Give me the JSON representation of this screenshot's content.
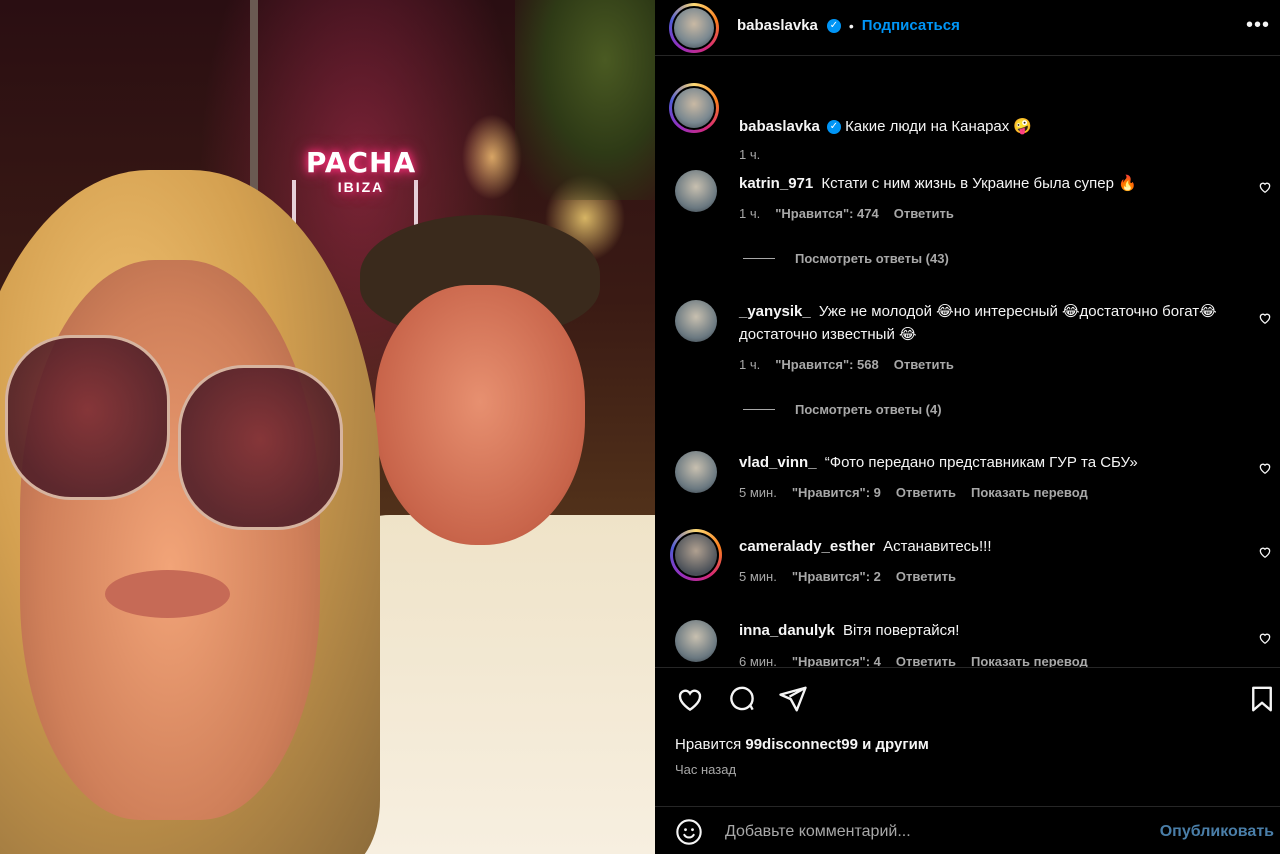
{
  "header": {
    "username": "babaslavka",
    "verified_icon": "verified-badge-icon",
    "follow_label": "Подписаться",
    "more_icon": "more-options-icon"
  },
  "caption": {
    "username": "babaslavka",
    "text": "Какие люди на Канарах 🤪",
    "time": "1 ч."
  },
  "photo": {
    "sign_text": "PACHA",
    "sign_subtext": "IBIZA"
  },
  "comments": [
    {
      "username": "katrin_971",
      "text": "Кстати с ним жизнь в Украине была супер 🔥",
      "time": "1 ч.",
      "likes": "\"Нравится\": 474",
      "reply": "Ответить",
      "view_replies": "Посмотреть ответы (43)"
    },
    {
      "username": "_yanysik_",
      "text": "Уже не молодой 😂но интересный 😂достаточно богат😂 достаточно известный 😂",
      "time": "1 ч.",
      "likes": "\"Нравится\": 568",
      "reply": "Ответить",
      "view_replies": "Посмотреть ответы (4)"
    },
    {
      "username": "vlad_vinn_",
      "text": "“Фото передано представникам ГУР та СБУ»",
      "time": "5 мин.",
      "likes": "\"Нравится\": 9",
      "reply": "Ответить",
      "translate": "Показать перевод"
    },
    {
      "username": "cameralady_esther",
      "text": "Астанавитесь!!!",
      "time": "5 мин.",
      "likes": "\"Нравится\": 2",
      "reply": "Ответить"
    },
    {
      "username": "inna_danulyk",
      "text": "Вітя повертайся!",
      "time": "6 мин.",
      "likes": "\"Нравится\": 4",
      "reply": "Ответить",
      "translate": "Показать перевод"
    }
  ],
  "actions": {
    "like_icon": "heart-icon",
    "comment_icon": "comment-icon",
    "share_icon": "share-icon",
    "save_icon": "bookmark-icon"
  },
  "likes_summary": {
    "prefix": "Нравится",
    "user": "99disconnect99",
    "suffix": "и другим"
  },
  "post_time": "Час назад",
  "composer": {
    "emoji_icon": "emoji-icon",
    "placeholder": "Добавьте комментарий...",
    "post_label": "Опубликовать"
  },
  "colors": {
    "accent": "#0095f6",
    "secondary_text": "#a8a8a8",
    "background": "#000000"
  }
}
